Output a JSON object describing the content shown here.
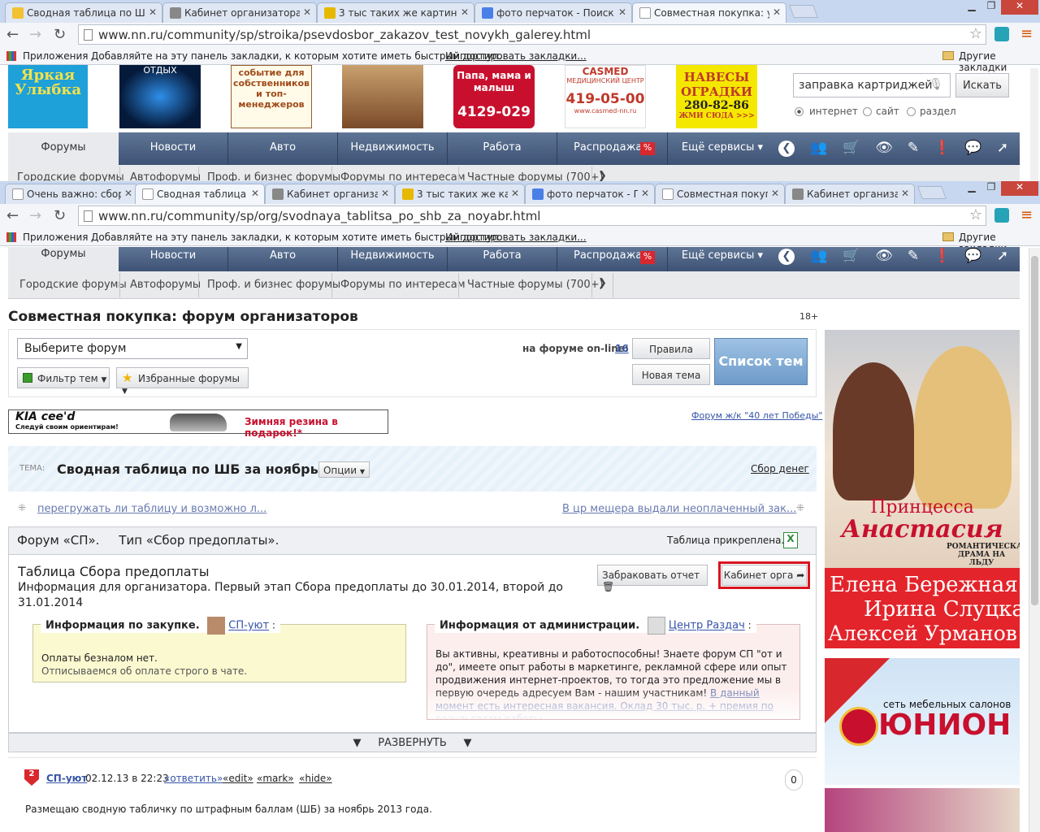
{
  "back_window": {
    "tabs": [
      "Сводная таблица по ШБ",
      "Кабинет организатора",
      "3 тыс таких же картинок",
      "фото перчаток - Поиск в",
      "Совместная покупка: ую"
    ],
    "url": "www.nn.ru/community/sp/stroika/psevdosbor_zakazov_test_novykh_galerey.html",
    "ads": {
      "a1": "Яркая Улыбка",
      "a2": "ОТДЫХ",
      "a3": "событие для собственников и топ-менеджеров",
      "a5_1": "Папа, мама и малыш",
      "a5_2": "4129-029",
      "a6_1": "CASMED",
      "a6_2": "МЕДИЦИНСКИЙ ЦЕНТР",
      "a6_3": "419-05-00",
      "a6_4": "www.casmed-nn.ru",
      "a7_1": "НАВЕСЫ",
      "a7_2": "ОГРАДКИ",
      "a7_3": "280-82-86",
      "a7_4": "ЖМИ СЮДА >>>"
    },
    "search": {
      "value": "заправка картриджей",
      "button": "Искать",
      "radios": [
        "интернет",
        "сайт",
        "раздел"
      ]
    },
    "subnav": [
      "Городские форумы",
      "Автофорумы",
      "Проф. и бизнес форумы",
      "Форумы по интересам",
      "Частные форумы (700+)"
    ]
  },
  "window": {
    "tabs": [
      "Очень важно: сбор",
      "Сводная таблица п",
      "Кабинет организат",
      "3 тыс таких же карт",
      "фото перчаток - По",
      "Совместная покуп",
      "Кабинет организат"
    ],
    "url": "www.nn.ru/community/sp/org/svodnaya_tablitsa_po_shb_za_noyabr.html"
  },
  "bookmarks": {
    "apps": "Приложения",
    "hint": "Добавляйте на эту панель закладки, к которым хотите иметь быстрый доступ.",
    "import": "Импортировать закладки...",
    "other": "Другие закладки"
  },
  "nav": {
    "items": [
      "Форумы",
      "Новости",
      "Авто",
      "Недвижимость",
      "Работа",
      "Распродажа",
      "Ещё сервисы ▾"
    ],
    "sale_badge": "%"
  },
  "subnav": [
    "Городские форумы",
    "Автофорумы",
    "Проф. и бизнес форумы",
    "Форумы по интересам",
    "Частные форумы (700+)"
  ],
  "page": {
    "title": "Совместная покупка: форум организаторов",
    "age": "18+",
    "select_forum": "Выберите форум",
    "filter": "Фильтр тем",
    "favorites": "Избранные форумы",
    "online_label": "на форуме on-line:",
    "online_count": "16",
    "rules": "Правила",
    "new_topic": "Новая тема",
    "topics_list": "Список тем",
    "ad_banner": {
      "brand": "KIA cee'd",
      "slogan": "Следуй своим ориентирам!",
      "offer": "Зимняя резина в подарок!*"
    },
    "side_link": "Форум ж/к \"40 лет Победы\"",
    "topic": {
      "label": "ТЕМА:",
      "title": "Сводная таблица по ШБ за ноябрь",
      "options": "Опции",
      "money": "Сбор денег"
    },
    "prev_link": "перегружать ли таблицу и возможно л...",
    "next_link": "В цр мещера выдали неоплаченный зак...",
    "forum_line": "Форум «СП».     Тип «Сбор предоплаты».",
    "pinned": "Таблица прикреплена.",
    "sbor": {
      "title": "Таблица Сбора предоплаты",
      "desc": "Информация для организатора. Первый этап Сбора предоплаты до 30.01.2014, второй до 31.01.2014",
      "reject": "Забраковать отчет",
      "cabinet": "Кабинет орга"
    },
    "info_left": {
      "label": "Информация по закупке.",
      "user": "СП-уют",
      "line1": "Оплаты безналом нет.",
      "line2": "Отписываемся об оплате строго в чате."
    },
    "info_right": {
      "label": "Информация от администрации.",
      "user": "Центр Раздач",
      "text": "Вы активны, креативны и работоспособны! Знаете форум СП \"от и до\", имеете опыт работы в маркетинге, рекламной сфере или опыт продвижения интернет-проектов, то тогда это предложение мы в первую очередь адресуем Вам - нашим участникам!",
      "link": "В данный момент есть интересная вакансия. Оклад 30 тыс. р. + премия по результатам работы"
    },
    "expand": "РАЗВЕРНУТЬ",
    "post": {
      "author": "СП-уют",
      "date": "02.12.13 в 22:23",
      "reply": "«ответить»",
      "edit": "«edit»",
      "mark": "«mark»",
      "hide": "«hide»",
      "count": "0",
      "text": "Размещаю сводную табличку по штрафным баллам (ШБ) за ноябрь 2013 года."
    }
  },
  "right_ads": {
    "title1": "Принцесса",
    "title2": "Анастасия",
    "sub": "РОМАНТИЧЕСКАЯ ДРАМА НА ЛЬДУ",
    "names": [
      "Елена Бережная",
      "Ирина Слуцкая",
      "Алексей Урманов"
    ],
    "union_small": "сеть мебельных салонов",
    "union_big": "ЮНИОН"
  }
}
